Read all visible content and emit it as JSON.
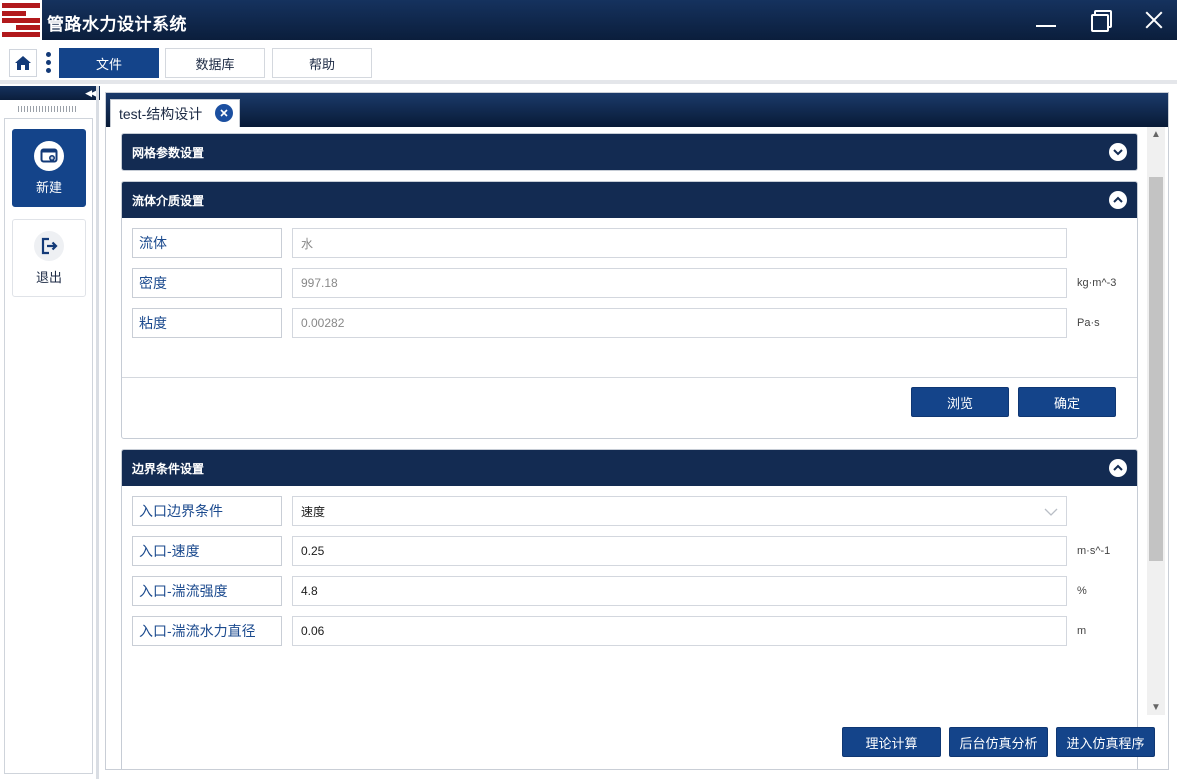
{
  "window": {
    "title": "管路水力设计系统"
  },
  "menu": {
    "items": [
      "文件",
      "数据库",
      "帮助"
    ],
    "active": "文件"
  },
  "sidebar": {
    "items": [
      {
        "label": "新建",
        "icon": "new-file-icon",
        "active": true
      },
      {
        "label": "退出",
        "icon": "logout-icon",
        "active": false
      }
    ]
  },
  "tab": {
    "label": "test-结构设计"
  },
  "sections": {
    "grid": {
      "title": "网格参数设置",
      "collapsed": true
    },
    "fluid": {
      "title": "流体介质设置",
      "rows": [
        {
          "label": "流体",
          "value": "水",
          "unit": ""
        },
        {
          "label": "密度",
          "value": "997.18",
          "unit": "kg·m^-3"
        },
        {
          "label": "粘度",
          "value": "0.00282",
          "unit": "Pa·s"
        }
      ],
      "browse_label": "浏览",
      "confirm_label": "确定"
    },
    "boundary": {
      "title": "边界条件设置",
      "rows": [
        {
          "label": "入口边界条件",
          "value": "速度",
          "unit": ""
        },
        {
          "label": "入口-速度",
          "value": "0.25",
          "unit": "m·s^-1"
        },
        {
          "label": "入口-湍流强度",
          "value": "4.8",
          "unit": "%"
        },
        {
          "label": "入口-湍流水力直径",
          "value": "0.06",
          "unit": "m"
        }
      ]
    }
  },
  "actions": {
    "theory_calc": "理论计算",
    "background_sim": "后台仿真分析",
    "enter_sim": "进入仿真程序"
  },
  "colors": {
    "primary": "#14448a",
    "header": "#132b52",
    "brand_red": "#b2191c"
  }
}
